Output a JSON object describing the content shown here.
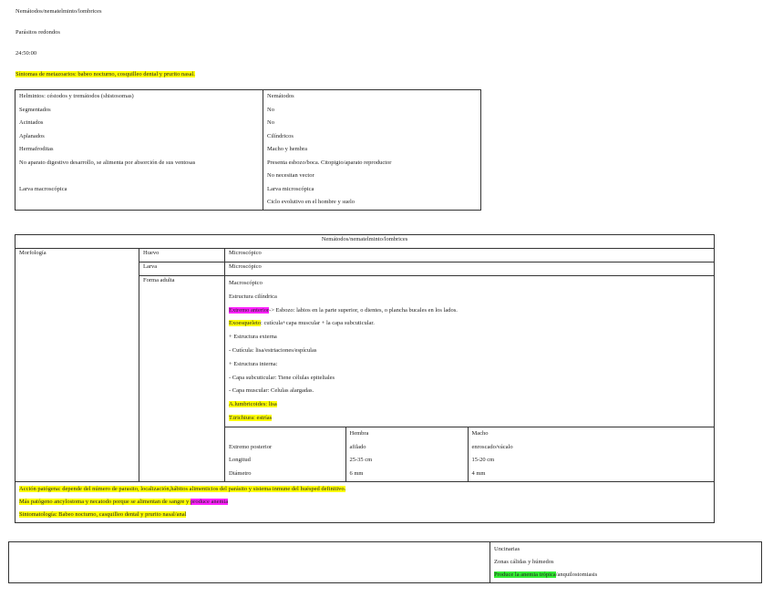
{
  "header": {
    "title": "Nemátodos/nematelminto/lombrices",
    "subtitle": "Parásitos redondos",
    "time": "24:50:00",
    "symptoms": "Síntomas de metazoarios: babeo nocturno, cosquilleo dental y prurito nasal."
  },
  "comparison": {
    "left": [
      "Helmintos: céstodos y tremátodos (shistosomas)",
      "Segmentados",
      "Acintados",
      "Aplanados",
      "Hermafroditas",
      "No aparato digestivo desarrollo, se alimenta por absorción de sus ventosas",
      "",
      "Larva macroscópica",
      ""
    ],
    "right": [
      "Nemátodos",
      "No",
      "No",
      "Cilíndricos",
      "Macho y hembra",
      "Presenta esbozo/boca. Citopigio/aparato reproductor",
      "No necesitan vector",
      "Larva microscópica",
      "Ciclo evolutivo en el hombre y suelo"
    ]
  },
  "main": {
    "title": "Nemátodos/nematelminto/lombrices",
    "morfologia": "Morfología",
    "huevo": {
      "label": "Huevo",
      "value": "Microscópico"
    },
    "larva": {
      "label": "Larva",
      "value": "Microscópico"
    },
    "adulta": {
      "label": "Forma adulta",
      "macro": "Macroscópico",
      "estructura": "Estructura cilíndrica",
      "extremo_label": "Extremo anterior",
      "extremo_text": "-> Esbozo: labios en la parte superior, o dientes, o plancha bucales en los lados.",
      "exo_label": "Exoesqueleto",
      "exo_text": ": cutícula+capa muscular + la capa subcuticular.",
      "externa": "+ Estructura externa",
      "cuticula": "- Cutícula: lisa/estriaciones/espículas",
      "interna": "+ Estructura interna:",
      "subcut": "- Capa subcuticular: Tiene células epiteliales",
      "muscular": "- Capa muscular: Celulas alargadas.",
      "lumbricoides": "A.lumbricoides: lisa",
      "trichiura": "T.trichiura: estrías"
    },
    "sex_table": {
      "headers": [
        "",
        "Hembra",
        "Macho"
      ],
      "rows": [
        [
          "Extremo posterior",
          "afilado",
          "enroscado/vácalo"
        ],
        [
          "Longitud",
          "25-35 cm",
          "15-20 cm"
        ],
        [
          "Diámetro",
          "6 mm",
          "4 mm"
        ]
      ]
    },
    "footer": {
      "accion": "Acción patógena: depende del número de parasito, localización,hábitos alimenticios del parásito y sistema inmune del huésped definitivo.",
      "patogeno_text": "Más patógeno ancylostoma y necatodo porque se alimentan de sangre y ",
      "patogeno_hl": "produce anemia",
      "sintomatologia": "Sintomatología: Babeo nocturno, casquilleo dental y prurito nasal/anal"
    }
  },
  "uncinarias": {
    "title": "Uncinarias",
    "zonas": "Zonas cálidas y húmedos",
    "anemia_hl": "Produce la anemia trópica",
    "anemia_rest": "/anquilostomiasis"
  },
  "colors": {
    "highlight_yellow": "#ffff00",
    "highlight_magenta": "#ff22ff",
    "highlight_green": "#33ee33"
  }
}
